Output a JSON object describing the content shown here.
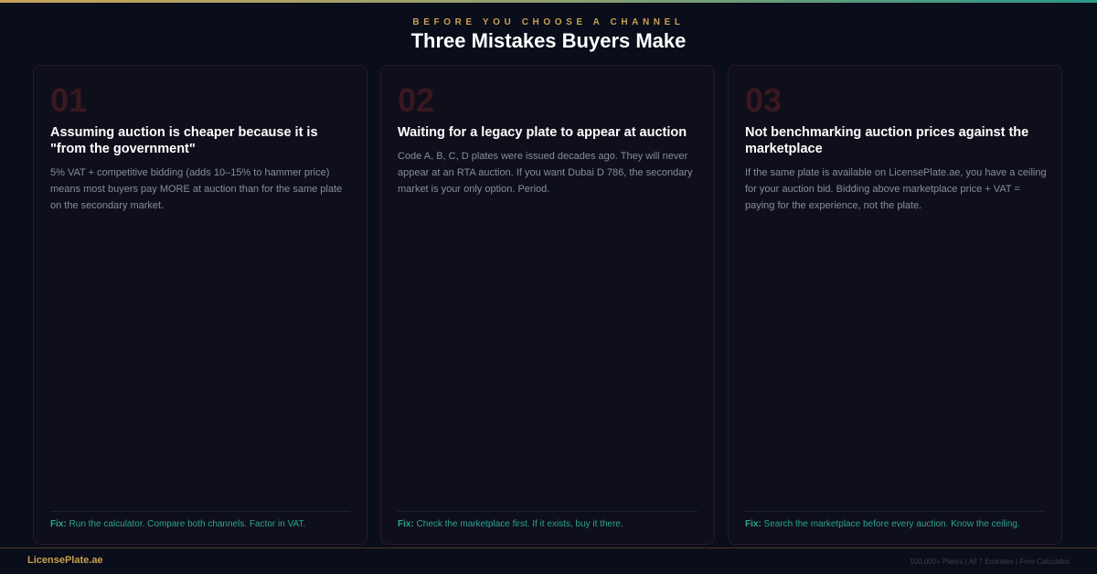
{
  "header": {
    "eyebrow": "BEFORE YOU CHOOSE A CHANNEL",
    "title": "Three Mistakes Buyers Make"
  },
  "cards": [
    {
      "number": "01",
      "title": "Assuming auction is cheaper because it is \"from the government\"",
      "body": "5% VAT + competitive bidding (adds 10–15% to hammer price) means most buyers pay MORE at auction than for the same plate on the secondary market.",
      "fix_label": "Fix:",
      "fix_text": " Run the calculator. Compare both channels. Factor in VAT."
    },
    {
      "number": "02",
      "title": "Waiting for a legacy plate to appear at auction",
      "body": "Code A, B, C, D plates were issued decades ago. They will never appear at an RTA auction. If you want Dubai D 786, the secondary market is your only option. Period.",
      "fix_label": "Fix:",
      "fix_text": " Check the marketplace first. If it exists, buy it there."
    },
    {
      "number": "03",
      "title": "Not benchmarking auction prices against the marketplace",
      "body": "If the same plate is available on LicensePlate.ae, you have a ceiling for your auction bid. Bidding above marketplace price + VAT = paying for the experience, not the plate.",
      "fix_label": "Fix:",
      "fix_text": " Search the marketplace before every auction. Know the ceiling."
    }
  ],
  "footer": {
    "brand": "LicensePlate.ae",
    "meta": "100,000+ Plates | All 7 Emirates | Free Calculator"
  },
  "colors": {
    "background": "#0a0d1a",
    "accent_gold": "#c9a050",
    "accent_teal": "#2aa394",
    "card_number": "#3a1820"
  }
}
